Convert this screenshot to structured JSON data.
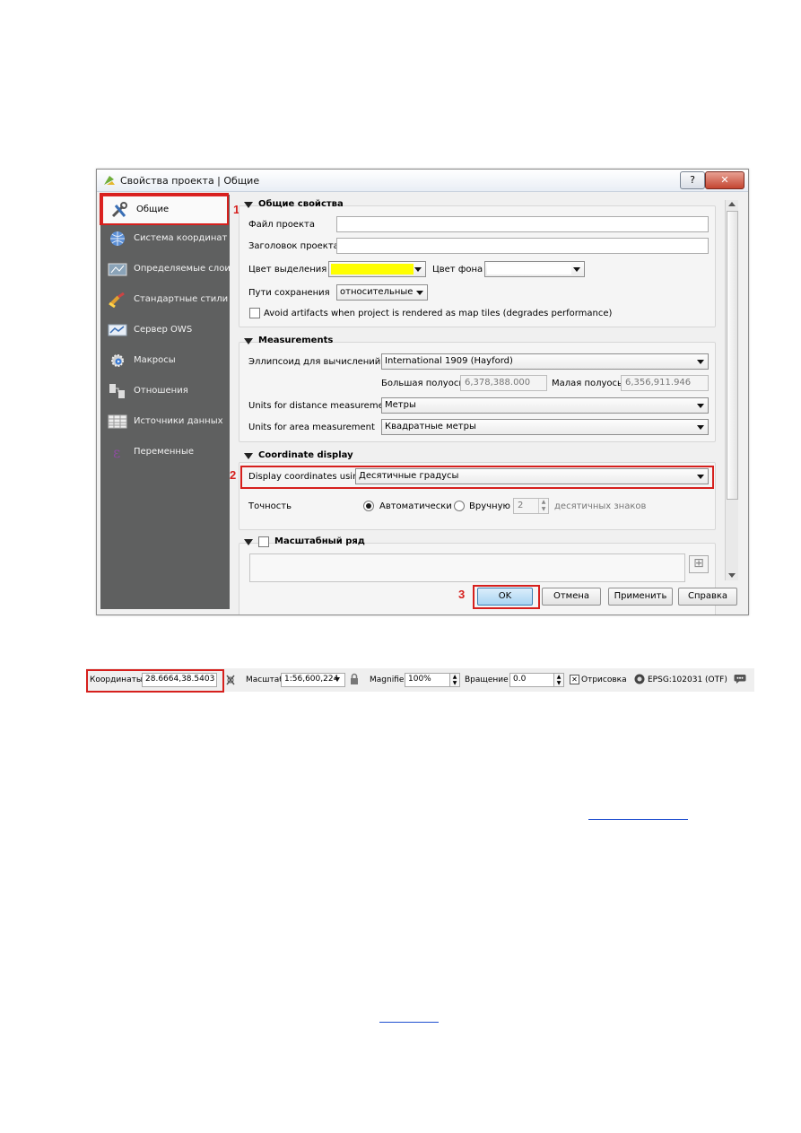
{
  "dialog": {
    "title": "Свойства проекта | Общие",
    "help_button": "?",
    "close_button": "✕"
  },
  "sidebar": {
    "items": [
      {
        "label": "Общие",
        "icon": "tools-icon"
      },
      {
        "label": "Система координат",
        "icon": "globe-icon"
      },
      {
        "label": "Определяемые слои",
        "icon": "layers-icon"
      },
      {
        "label": "Стандартные стили",
        "icon": "brush-icon"
      },
      {
        "label": "Сервер OWS",
        "icon": "ows-icon"
      },
      {
        "label": "Макросы",
        "icon": "macro-gear-icon"
      },
      {
        "label": "Отношения",
        "icon": "relations-icon"
      },
      {
        "label": "Источники данных",
        "icon": "table-icon"
      },
      {
        "label": "Переменные",
        "icon": "epsilon-icon"
      }
    ]
  },
  "general": {
    "title": "Общие свойства",
    "project_file_label": "Файл проекта",
    "project_file_value": "",
    "project_title_label": "Заголовок проекта",
    "project_title_value": "",
    "selection_color_label": "Цвет выделения",
    "selection_color": "#ffff00",
    "background_color_label": "Цвет фона",
    "background_color": "#ffffff",
    "save_paths_label": "Пути сохранения",
    "save_paths_value": "относительные",
    "avoid_artifacts_label": "Avoid artifacts when project is rendered as map tiles (degrades performance)"
  },
  "measurements": {
    "title": "Measurements",
    "ellipsoid_label": "Эллипсоид для вычислений",
    "ellipsoid_value": "International 1909 (Hayford)",
    "semi_major_label": "Большая полуось",
    "semi_major_value": "6,378,388.000",
    "semi_minor_label": "Малая полуось",
    "semi_minor_value": "6,356,911.946",
    "distance_units_label": "Units for distance measurement",
    "distance_units_value": "Метры",
    "area_units_label": "Units for area measurement",
    "area_units_value": "Квадратные метры"
  },
  "coordinate_display": {
    "title": "Coordinate display",
    "display_using_label": "Display coordinates using",
    "display_using_value": "Десятичные градусы",
    "precision_label": "Точность",
    "auto_label": "Автоматически",
    "manual_label": "Вручную",
    "manual_value": "2",
    "decimals_label": "десятичных знаков"
  },
  "scales": {
    "title": "Масштабный ряд"
  },
  "buttons": {
    "ok": "OK",
    "cancel": "Отмена",
    "apply": "Применить",
    "help": "Справка"
  },
  "callouts": [
    "1",
    "2",
    "3"
  ],
  "statusbar": {
    "coords_label": "Координаты",
    "coords_value": "28.6664,38.5403",
    "scale_label": "Масштаб",
    "scale_value": "1:56,600,224",
    "magnifier_label": "Magnifier",
    "magnifier_value": "100%",
    "rotation_label": "Вращение",
    "rotation_value": "0.0",
    "render_label": "Отрисовка",
    "crs_label": "EPSG:102031 (OTF)"
  },
  "colors": {
    "sidebar": "#5f6060",
    "callout": "#d6201d",
    "link": "#1f4fd0"
  }
}
